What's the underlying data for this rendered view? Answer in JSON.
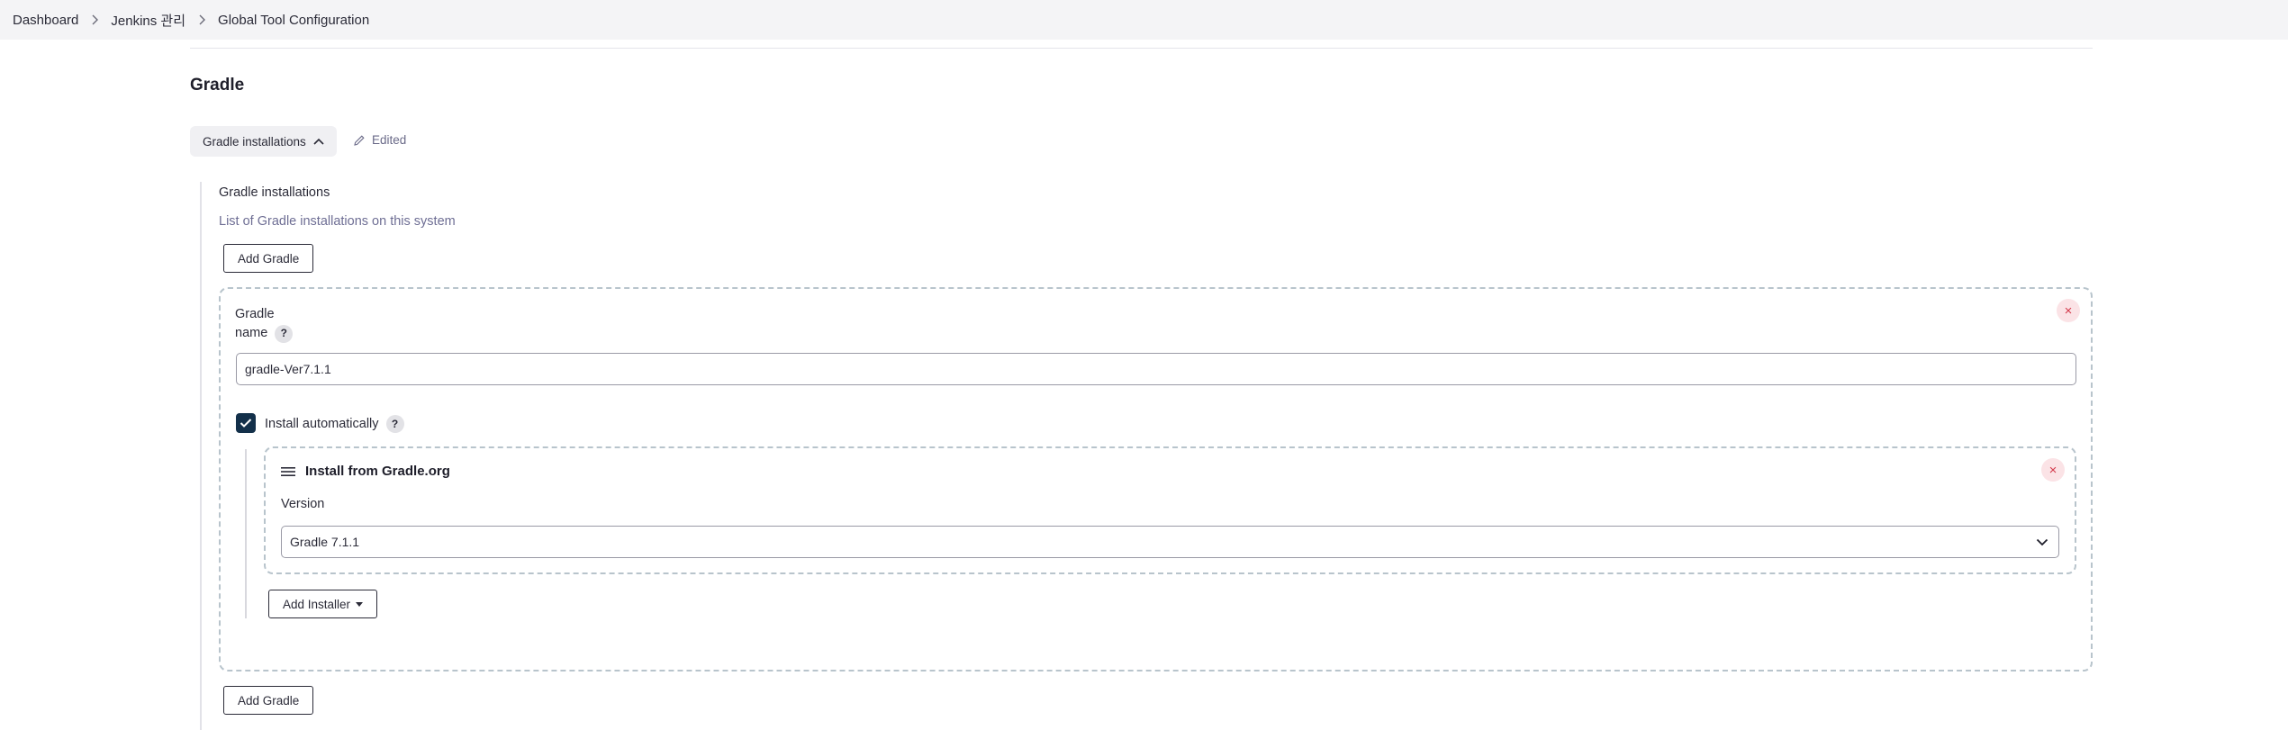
{
  "breadcrumb": {
    "items": [
      "Dashboard",
      "Jenkins 관리",
      "Global Tool Configuration"
    ]
  },
  "section": {
    "title": "Gradle",
    "toggle_label": "Gradle installations",
    "edited_label": "Edited"
  },
  "installations": {
    "label": "Gradle installations",
    "description": "List of Gradle installations on this system",
    "add_button_label": "Add Gradle",
    "add_button_bottom_label": "Add Gradle"
  },
  "gradle_item": {
    "name_label_line1": "Gradle",
    "name_label_line2": "name",
    "help_icon": "?",
    "name_value": "gradle-Ver7.1.1",
    "install_auto_label": "Install automatically",
    "install_auto_checked": true,
    "close_icon": "×",
    "installer": {
      "title": "Install from Gradle.org",
      "version_label": "Version",
      "version_value": "Gradle 7.1.1",
      "close_icon": "×"
    },
    "add_installer_label": "Add Installer"
  },
  "colors": {
    "breadcrumb_bg": "#f4f4f6",
    "checkbox": "#13304a",
    "close_bg": "#fbe3e6",
    "close_fg": "#d43a4c",
    "dashed_border": "#b8c4cc"
  },
  "icons": {
    "chevron_right": "chevron-right-icon",
    "chevron_up": "chevron-up-icon",
    "pencil": "pencil-icon",
    "hamburger": "hamburger-icon",
    "chevron_down": "chevron-down-icon",
    "caret_down": "caret-down-icon",
    "check": "check-icon",
    "close": "close-icon",
    "help": "help-icon"
  }
}
